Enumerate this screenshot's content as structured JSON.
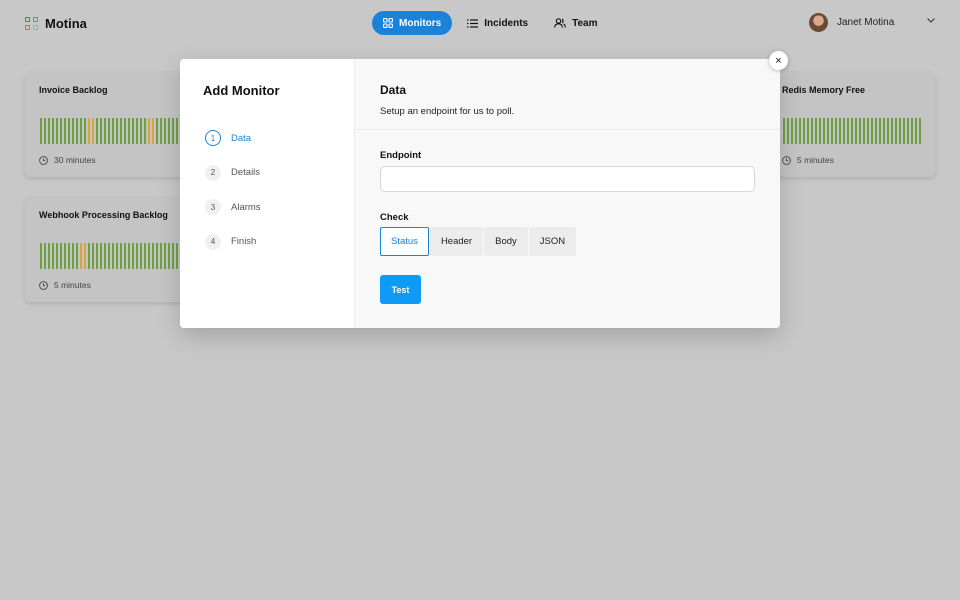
{
  "app": {
    "name": "Motina",
    "logo_colors": [
      "#3a6be0",
      "#d94fa6",
      "#2bb36a",
      "#e8a21c"
    ]
  },
  "nav": {
    "items": [
      {
        "label": "Monitors",
        "icon": "grid-icon",
        "active": true
      },
      {
        "label": "Incidents",
        "icon": "list-icon",
        "active": false
      },
      {
        "label": "Team",
        "icon": "users-icon",
        "active": false
      }
    ],
    "accent": "#1a82d9"
  },
  "user": {
    "name": "Janet Motina",
    "menu_icon": "chevron-down-icon"
  },
  "monitors": [
    {
      "title": "Invoice Backlog",
      "interval": "30 minutes",
      "status_history": [
        "ok",
        "ok",
        "ok",
        "ok",
        "ok",
        "ok",
        "ok",
        "ok",
        "ok",
        "ok",
        "ok",
        "ok",
        "warn",
        "warn",
        "ok",
        "ok",
        "ok",
        "ok",
        "ok",
        "ok",
        "ok",
        "ok",
        "ok",
        "ok",
        "ok",
        "ok",
        "ok",
        "warn",
        "warn",
        "ok",
        "ok",
        "ok",
        "ok",
        "ok",
        "ok"
      ]
    },
    {
      "title": "Webhook Processing Backlog",
      "interval": "5 minutes",
      "status_history": [
        "ok",
        "ok",
        "ok",
        "ok",
        "ok",
        "ok",
        "ok",
        "ok",
        "ok",
        "ok",
        "warn",
        "warn",
        "ok",
        "ok",
        "ok",
        "ok",
        "ok",
        "ok",
        "ok",
        "ok",
        "ok",
        "ok",
        "ok",
        "ok",
        "ok",
        "ok",
        "ok",
        "ok",
        "ok",
        "ok",
        "ok",
        "ok",
        "ok",
        "ok",
        "ok"
      ]
    },
    {
      "title": "Redis Memory Free",
      "interval": "5 minutes",
      "status_history": [
        "ok",
        "ok",
        "ok",
        "ok",
        "ok",
        "ok",
        "ok",
        "ok",
        "ok",
        "ok",
        "ok",
        "ok",
        "ok",
        "ok",
        "ok",
        "ok",
        "ok",
        "ok",
        "ok",
        "ok",
        "ok",
        "ok",
        "ok",
        "ok",
        "ok",
        "ok",
        "ok",
        "ok",
        "ok",
        "ok",
        "ok",
        "ok",
        "ok",
        "ok",
        "ok"
      ]
    }
  ],
  "status_colors": {
    "ok": "#6ea043",
    "warn": "#d9a53a"
  },
  "modal": {
    "title": "Add Monitor",
    "close_label": "×",
    "steps": [
      {
        "number": "1",
        "label": "Data",
        "active": true
      },
      {
        "number": "2",
        "label": "Details",
        "active": false
      },
      {
        "number": "3",
        "label": "Alarms",
        "active": false
      },
      {
        "number": "4",
        "label": "Finish",
        "active": false
      }
    ],
    "section_title": "Data",
    "section_subtitle": "Setup an endpoint for us to poll.",
    "endpoint": {
      "label": "Endpoint",
      "value": "",
      "placeholder": ""
    },
    "check": {
      "label": "Check",
      "options": [
        "Status",
        "Header",
        "Body",
        "JSON"
      ],
      "selected": "Status"
    },
    "test_label": "Test"
  }
}
